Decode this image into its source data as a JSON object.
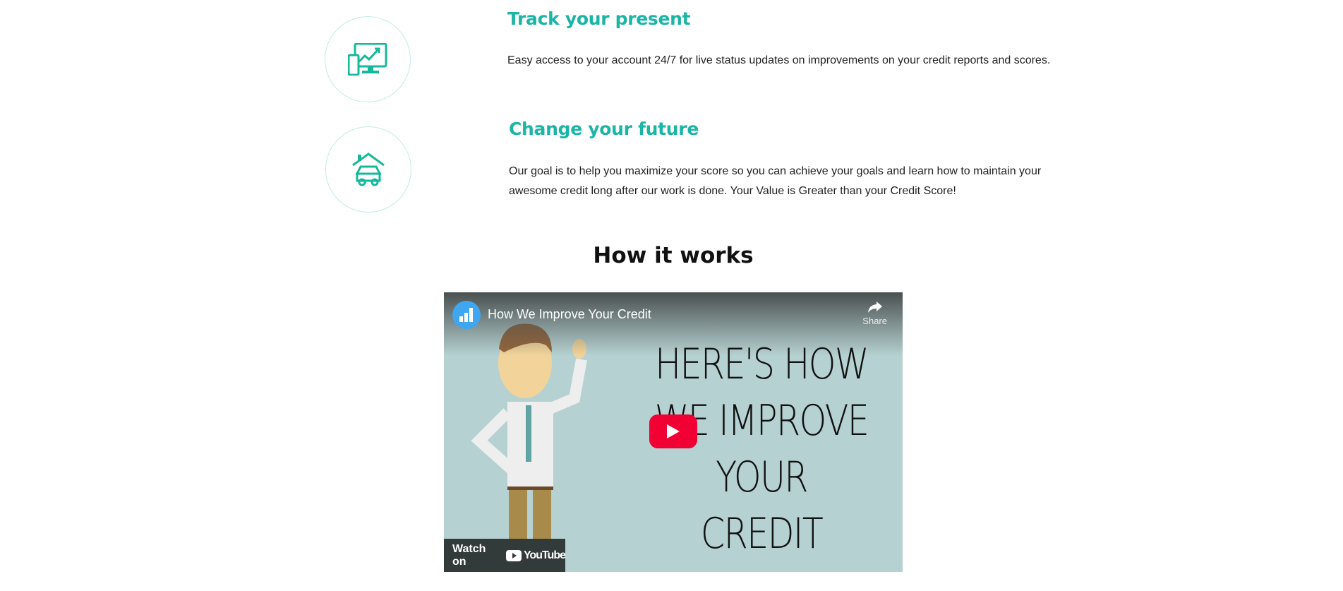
{
  "features": [
    {
      "title": "Track your present",
      "text": "Easy access to your account 24/7 for live status updates on improvements on your credit reports and scores.",
      "icon": "devices-chart-icon"
    },
    {
      "title": "Change your future",
      "text_lines": [
        "Our goal is to help you maximize your score so you can achieve your goals and learn how to maintain your",
        "awesome credit long after our work is done. Your Value is Greater than your Credit Score!"
      ],
      "icon": "house-car-icon"
    }
  ],
  "how": {
    "heading": "How it works"
  },
  "video": {
    "title": "How We Improve Your Credit",
    "share": "Share",
    "thumb_lines": [
      "HERE'S HOW",
      "WE IMPROVE",
      "YOUR CREDIT"
    ],
    "watch_on": "Watch on",
    "youtube": "YouTube"
  },
  "colors": {
    "accent": "#1bb5a5",
    "play": "#f00033"
  }
}
